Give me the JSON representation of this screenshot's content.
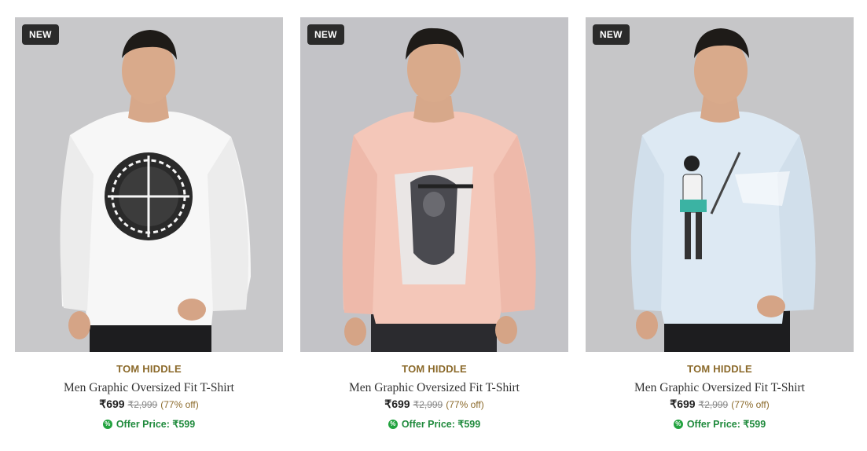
{
  "products": [
    {
      "badge": "NEW",
      "brand": "TOM HIDDLE",
      "title": "Men Graphic Oversized Fit T-Shirt",
      "price": "₹699",
      "mrp": "₹2,999",
      "discount": "(77% off)",
      "offer_label": "Offer Price: ₹599",
      "shirt_color": "#f7f7f7",
      "bg_color": "#c8c8ca"
    },
    {
      "badge": "NEW",
      "brand": "TOM HIDDLE",
      "title": "Men Graphic Oversized Fit T-Shirt",
      "price": "₹699",
      "mrp": "₹2,999",
      "discount": "(77% off)",
      "offer_label": "Offer Price: ₹599",
      "shirt_color": "#f4c7b9",
      "bg_color": "#c3c3c7"
    },
    {
      "badge": "NEW",
      "brand": "TOM HIDDLE",
      "title": "Men Graphic Oversized Fit T-Shirt",
      "price": "₹699",
      "mrp": "₹2,999",
      "discount": "(77% off)",
      "offer_label": "Offer Price: ₹599",
      "shirt_color": "#dde9f3",
      "bg_color": "#c6c6c8"
    }
  ],
  "colors": {
    "brand": "#8b6a2b",
    "offer_green": "#1f8a3c",
    "badge_bg": "#2b2b2b"
  },
  "icons": {
    "offer": "percent-badge-icon"
  }
}
